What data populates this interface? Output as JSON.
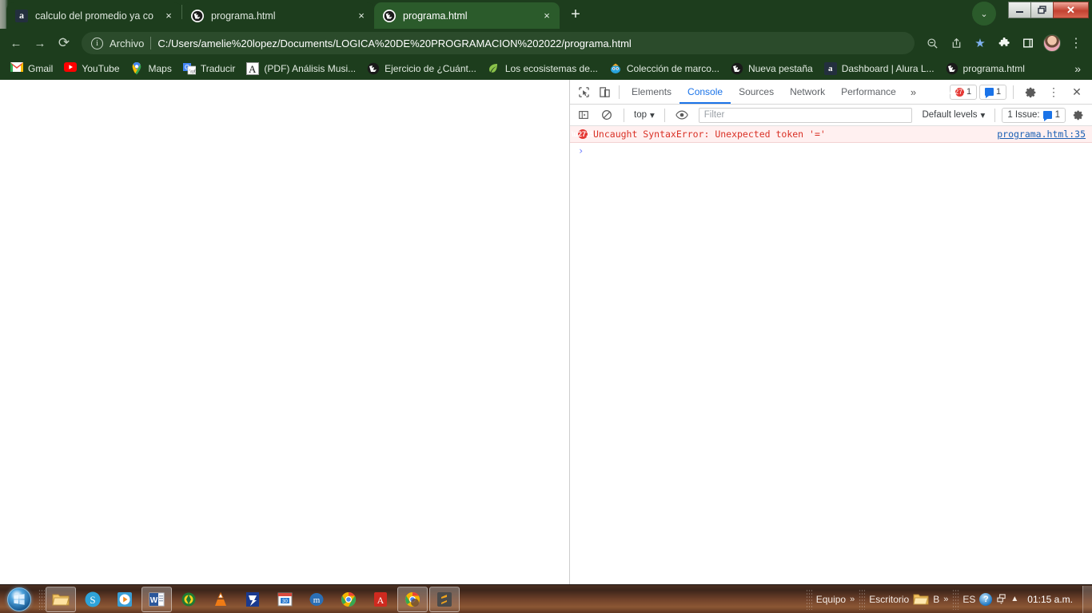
{
  "browser": {
    "tabs": [
      {
        "title": "calculo del promedio ya con Mat",
        "favicon": "amazon-icon",
        "active": false,
        "close_label": "×"
      },
      {
        "title": "programa.html",
        "favicon": "globe-icon",
        "active": false,
        "close_label": "×"
      },
      {
        "title": "programa.html",
        "favicon": "globe-icon",
        "active": true,
        "close_label": "×"
      }
    ],
    "new_tab_label": "+",
    "window_controls": {
      "minimize": "—",
      "maximize": "❑",
      "close": "✕",
      "chevron": "⌄"
    },
    "toolbar": {
      "back": "←",
      "forward": "→",
      "reload": "⟳",
      "zoom_icon": "search-minus-icon",
      "share_icon": "share-icon",
      "bookmark_star": "★",
      "extensions_icon": "puzzle-icon",
      "sidepanel_icon": "side-panel-icon",
      "menu_icon": "⋮"
    },
    "omnibox": {
      "info_glyph": "i",
      "scheme_label": "Archivo",
      "url": "C:/Users/amelie%20lopez/Documents/LOGICA%20DE%20PROGRAMACION%202022/programa.html"
    },
    "bookmarks": [
      {
        "label": "Gmail",
        "icon": "gmail-icon"
      },
      {
        "label": "YouTube",
        "icon": "youtube-icon"
      },
      {
        "label": "Maps",
        "icon": "maps-icon"
      },
      {
        "label": "Traducir",
        "icon": "translate-icon"
      },
      {
        "label": "(PDF) Análisis Musi...",
        "icon": "academia-icon"
      },
      {
        "label": "Ejercicio de ¿Cuánt...",
        "icon": "globe-icon"
      },
      {
        "label": "Los ecosistemas de...",
        "icon": "leaf-icon"
      },
      {
        "label": "Colección de marco...",
        "icon": "character-icon"
      },
      {
        "label": "Nueva pestaña",
        "icon": "globe-icon"
      },
      {
        "label": "Dashboard | Alura L...",
        "icon": "alura-icon"
      },
      {
        "label": "programa.html",
        "icon": "globe-icon"
      }
    ],
    "bookmarks_overflow": "»"
  },
  "devtools": {
    "tabs": [
      {
        "label": "Elements",
        "selected": false
      },
      {
        "label": "Console",
        "selected": true
      },
      {
        "label": "Sources",
        "selected": false
      },
      {
        "label": "Network",
        "selected": false
      },
      {
        "label": "Performance",
        "selected": false
      }
    ],
    "more_tabs": "»",
    "inspect_icon": "inspect-element-icon",
    "device_icon": "device-toolbar-icon",
    "error_badge_count": "1",
    "message_badge_count": "1",
    "settings_icon": "gear-icon",
    "menu_icon": "⋮",
    "close_icon": "✕",
    "filterbar": {
      "sidebar_toggle_icon": "console-sidebar-icon",
      "clear_icon": "clear-console-icon",
      "context_selector": "top",
      "context_caret": "▾",
      "eye_icon": "live-expression-icon",
      "filter_placeholder": "Filter",
      "levels_label": "Default levels",
      "levels_caret": "▾",
      "issues_label": "1 Issue:",
      "issues_count": "1",
      "settings_icon": "gear-icon"
    },
    "console": {
      "error_message": "Uncaught SyntaxError: Unexpected token '='",
      "error_source": "programa.html:35",
      "prompt_caret": "›"
    }
  },
  "taskbar": {
    "start_label": "start-orb",
    "items": [
      {
        "icon": "windows-explorer-icon",
        "pressed": true
      },
      {
        "icon": "skype-icon",
        "pressed": false
      },
      {
        "icon": "media-player-icon",
        "pressed": false
      },
      {
        "icon": "word-icon",
        "pressed": true
      },
      {
        "icon": "kaspersky-icon",
        "pressed": false
      },
      {
        "icon": "vlc-icon",
        "pressed": false
      },
      {
        "icon": "zip-icon",
        "pressed": false
      },
      {
        "icon": "calendar-icon",
        "pressed": false
      },
      {
        "icon": "mu-app-icon",
        "pressed": false
      },
      {
        "icon": "chrome-icon",
        "pressed": false
      },
      {
        "icon": "acrobat-icon",
        "pressed": false
      },
      {
        "icon": "chrome-window-icon",
        "pressed": true
      },
      {
        "icon": "sublime-icon",
        "pressed": true
      }
    ],
    "tray": {
      "equipo_label": "Equipo",
      "equipo_caret": "»",
      "escritorio_label": "Escritorio",
      "b_label": "B",
      "b_caret": "»",
      "language": "ES",
      "help_glyph": "?",
      "network_icon": "network-icon",
      "show_hidden": "▲",
      "clock": "01:15 a.m."
    }
  }
}
